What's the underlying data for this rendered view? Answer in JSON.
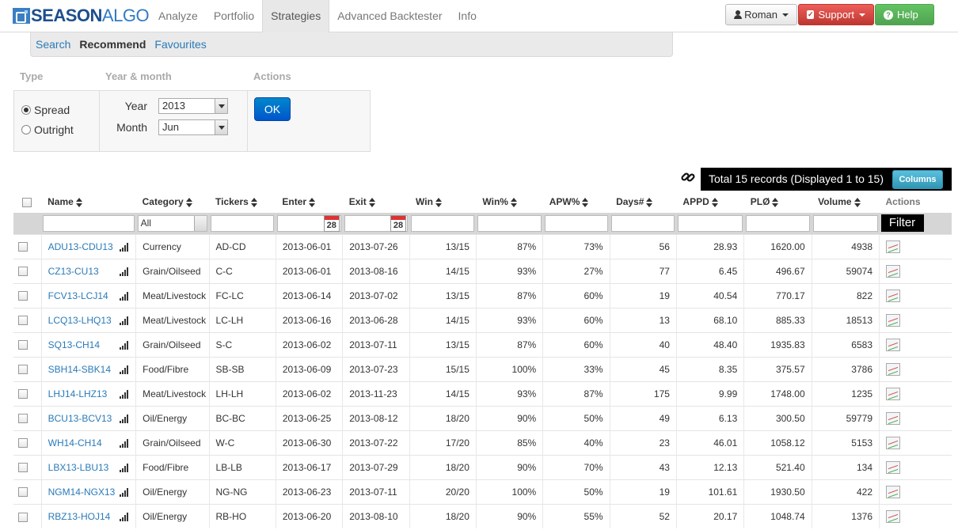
{
  "brand": {
    "name_part1": "SEASON",
    "name_part2": "ALGO"
  },
  "nav": {
    "items": [
      "Analyze",
      "Portfolio",
      "Strategies",
      "Advanced Backtester",
      "Info"
    ],
    "active": "Strategies"
  },
  "user_menu": {
    "user_label": "Roman",
    "support_label": "Support",
    "help_label": "Help"
  },
  "subnav": {
    "items": [
      "Search",
      "Recommend",
      "Favourites"
    ],
    "active": "Recommend"
  },
  "filters": {
    "type_label": "Type",
    "yearmonth_label": "Year & month",
    "actions_label": "Actions",
    "type_options": [
      "Spread",
      "Outright"
    ],
    "type_selected": "Spread",
    "year_label": "Year",
    "year_value": "2013",
    "month_label": "Month",
    "month_value": "Jun",
    "ok_label": "OK"
  },
  "records": {
    "summary": "Total 15 records (Displayed 1 to 15)",
    "columns_label": "Columns"
  },
  "table": {
    "headers": [
      "Name",
      "Category",
      "Tickers",
      "Enter",
      "Exit",
      "Win",
      "Win%",
      "APW%",
      "Days#",
      "APPD",
      "PLØ",
      "Volume",
      "Actions"
    ],
    "category_filter_value": "All",
    "calendar_day": "28",
    "filter_label": "Filter",
    "rows": [
      [
        "ADU13-CDU13",
        "Currency",
        "AD-CD",
        "2013-06-01",
        "2013-07-26",
        "13/15",
        "87%",
        "73%",
        "56",
        "28.93",
        "1620.00",
        "4938"
      ],
      [
        "CZ13-CU13",
        "Grain/Oilseed",
        "C-C",
        "2013-06-01",
        "2013-08-16",
        "14/15",
        "93%",
        "27%",
        "77",
        "6.45",
        "496.67",
        "59074"
      ],
      [
        "FCV13-LCJ14",
        "Meat/Livestock",
        "FC-LC",
        "2013-06-14",
        "2013-07-02",
        "13/15",
        "87%",
        "60%",
        "19",
        "40.54",
        "770.17",
        "822"
      ],
      [
        "LCQ13-LHQ13",
        "Meat/Livestock",
        "LC-LH",
        "2013-06-16",
        "2013-06-28",
        "14/15",
        "93%",
        "60%",
        "13",
        "68.10",
        "885.33",
        "18513"
      ],
      [
        "SQ13-CH14",
        "Grain/Oilseed",
        "S-C",
        "2013-06-02",
        "2013-07-11",
        "13/15",
        "87%",
        "60%",
        "40",
        "48.40",
        "1935.83",
        "6583"
      ],
      [
        "SBH14-SBK14",
        "Food/Fibre",
        "SB-SB",
        "2013-06-09",
        "2013-07-23",
        "15/15",
        "100%",
        "33%",
        "45",
        "8.35",
        "375.57",
        "3786"
      ],
      [
        "LHJ14-LHZ13",
        "Meat/Livestock",
        "LH-LH",
        "2013-06-02",
        "2013-11-23",
        "14/15",
        "93%",
        "87%",
        "175",
        "9.99",
        "1748.00",
        "1235"
      ],
      [
        "BCU13-BCV13",
        "Oil/Energy",
        "BC-BC",
        "2013-06-25",
        "2013-08-12",
        "18/20",
        "90%",
        "50%",
        "49",
        "6.13",
        "300.50",
        "59779"
      ],
      [
        "WH14-CH14",
        "Grain/Oilseed",
        "W-C",
        "2013-06-30",
        "2013-07-22",
        "17/20",
        "85%",
        "40%",
        "23",
        "46.01",
        "1058.12",
        "5153"
      ],
      [
        "LBX13-LBU13",
        "Food/Fibre",
        "LB-LB",
        "2013-06-17",
        "2013-07-29",
        "18/20",
        "90%",
        "70%",
        "43",
        "12.13",
        "521.40",
        "134"
      ],
      [
        "NGM14-NGX13",
        "Oil/Energy",
        "NG-NG",
        "2013-06-23",
        "2013-07-11",
        "20/20",
        "100%",
        "50%",
        "19",
        "101.61",
        "1930.50",
        "422"
      ],
      [
        "RBZ13-HOJ14",
        "Oil/Energy",
        "RB-HO",
        "2013-06-20",
        "2013-08-10",
        "18/20",
        "90%",
        "55%",
        "52",
        "20.17",
        "1048.74",
        "1376"
      ]
    ]
  },
  "colors": {
    "link": "#2a7ab8",
    "support": "#bd362f",
    "help": "#51a351",
    "primary": "#0055cc",
    "info": "#2f96b4"
  }
}
